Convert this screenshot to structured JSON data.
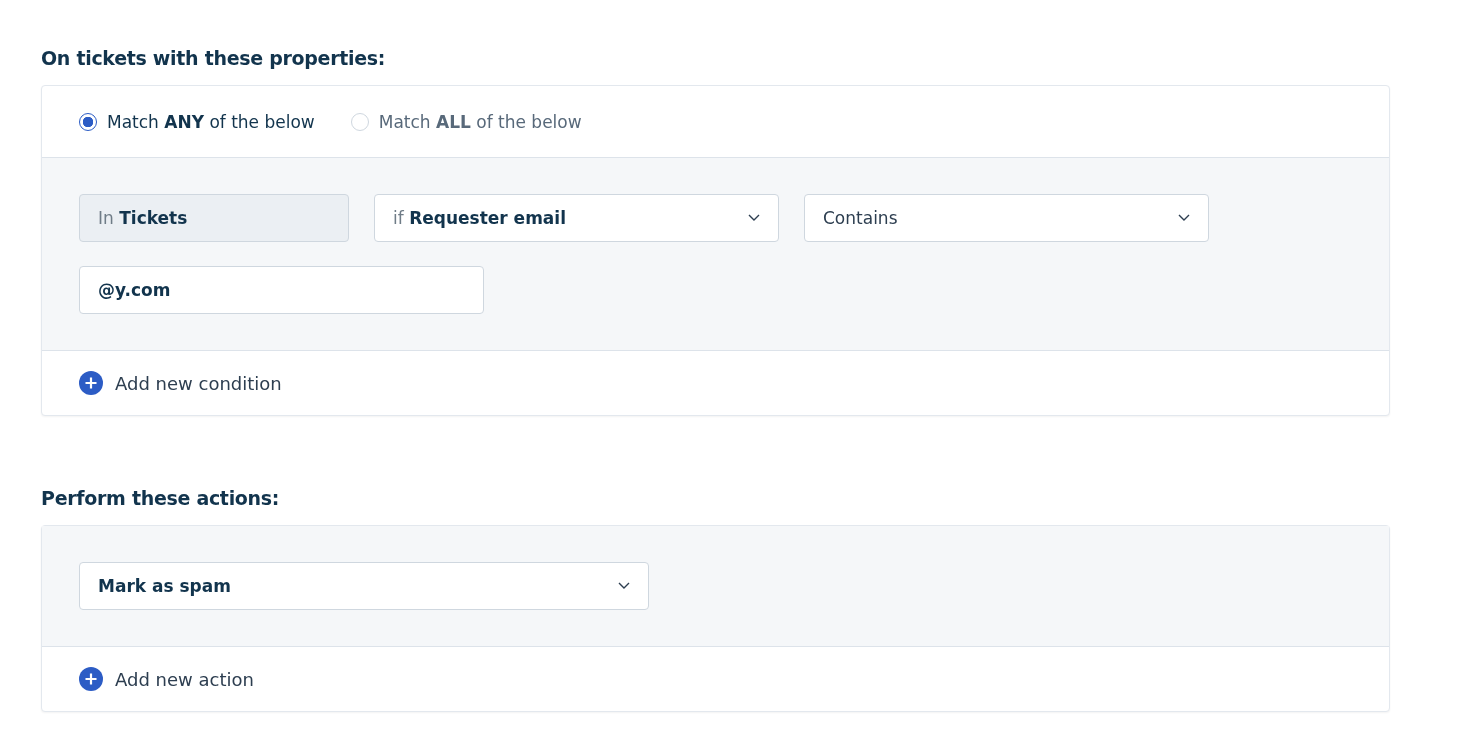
{
  "conditions_section": {
    "heading": "On tickets with these properties:",
    "match_options": [
      {
        "label": "Match **ANY** of the below",
        "selected": true
      },
      {
        "label": "Match **ALL** of the below",
        "selected": false
      }
    ],
    "scope_field": "In **Tickets**",
    "property_select": "if **Requester email**",
    "operator_select": "Contains",
    "value_input": "@y.com",
    "add_button": "Add new condition"
  },
  "actions_section": {
    "heading": "Perform these actions:",
    "action_select": "Mark as spam",
    "add_button": "Add new action"
  }
}
